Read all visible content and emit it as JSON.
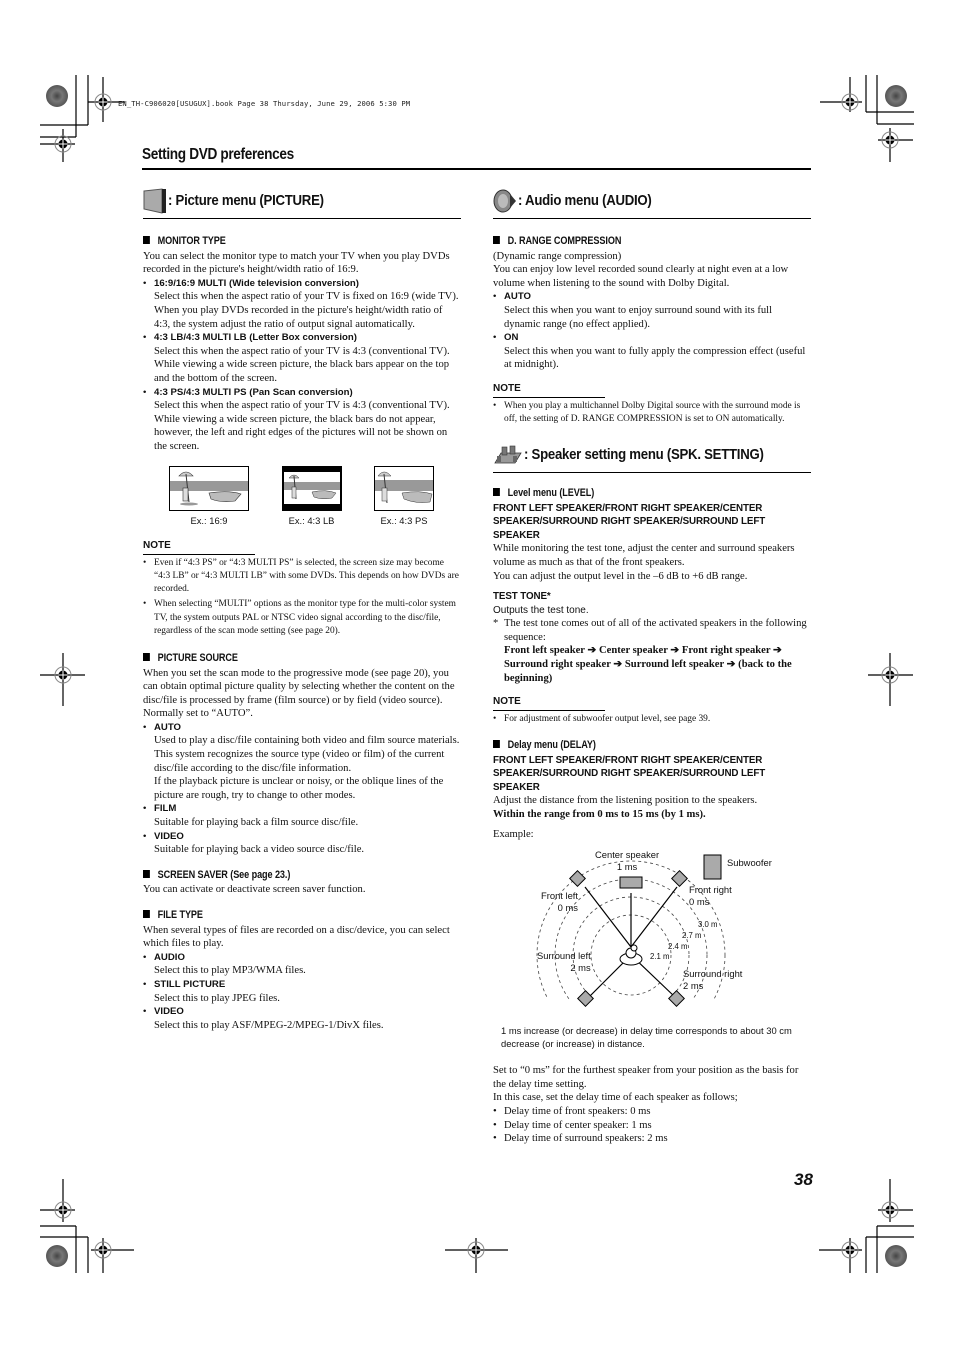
{
  "slug": "EN_TH-C906020[USUGUX].book  Page 38  Thursday, June 29, 2006  5:30 PM",
  "section_title": "Setting DVD preferences",
  "page_number": "38",
  "picture_menu": {
    "icon": "tv-screen-icon",
    "title": ": Picture menu (PICTURE)",
    "monitor_type": {
      "heading": "MONITOR TYPE",
      "intro": "You can select the monitor type to match your TV when you play DVDs recorded in the picture's height/width ratio of 16:9.",
      "options": [
        {
          "label": "16:9/16:9 MULTI (Wide television conversion)",
          "desc": [
            "Select this when the aspect ratio of your TV is fixed on 16:9 (wide TV).",
            "When you play DVDs recorded in the picture's height/width ratio of 4:3, the system adjust the ratio of output signal automatically."
          ]
        },
        {
          "label": "4:3 LB/4:3 MULTI LB (Letter Box conversion)",
          "desc": [
            "Select this when the aspect ratio of your TV is 4:3 (conventional TV). While viewing a wide screen picture, the black bars appear on the top and the bottom of the screen."
          ]
        },
        {
          "label": "4:3 PS/4:3 MULTI PS (Pan Scan conversion)",
          "desc": [
            "Select this when the aspect ratio of your TV is 4:3 (conventional TV). While viewing a wide screen picture, the black bars do not appear, however, the left and right edges of the pictures will not be shown on the screen."
          ]
        }
      ],
      "examples": [
        "Ex.: 16:9",
        "Ex.: 4:3 LB",
        "Ex.: 4:3 PS"
      ],
      "note_heading": "NOTE",
      "notes": [
        "Even if “4:3 PS” or “4:3 MULTI PS” is selected, the screen size may become “4:3 LB” or “4:3 MULTI LB” with some DVDs. This depends on how DVDs are recorded.",
        "When selecting “MULTI” options as the monitor type for the multi-color system TV, the system outputs PAL or NTSC video signal according to the disc/file, regardless of the scan mode setting (see page 20)."
      ]
    },
    "picture_source": {
      "heading": "PICTURE SOURCE",
      "intro": "When you set the scan mode to the progressive mode (see page 20), you can obtain optimal picture quality by selecting whether the content on the disc/file is processed by frame (film source) or by field (video source).",
      "default": "Normally set to “AUTO”.",
      "options": [
        {
          "label": "AUTO",
          "desc": [
            "Used to play a disc/file containing both video and film source materials.",
            "This system recognizes the source type (video or film) of the current disc/file according to the disc/file information.",
            "If the playback picture is unclear or noisy, or the oblique lines of the picture are rough, try to change to other modes."
          ]
        },
        {
          "label": "FILM",
          "desc": [
            "Suitable for playing back a film source disc/file."
          ]
        },
        {
          "label": "VIDEO",
          "desc": [
            "Suitable for playing back a video source disc/file."
          ]
        }
      ]
    },
    "screen_saver": {
      "heading": "SCREEN SAVER (See page 23.)",
      "text": "You can activate or deactivate screen saver function."
    },
    "file_type": {
      "heading": "FILE TYPE",
      "intro": "When several types of files are recorded on a disc/device, you can select which files to play.",
      "options": [
        {
          "label": "AUDIO",
          "desc": [
            "Select this to play MP3/WMA files."
          ]
        },
        {
          "label": "STILL PICTURE",
          "desc": [
            "Select this to play JPEG files."
          ]
        },
        {
          "label": "VIDEO",
          "desc": [
            "Select this to play ASF/MPEG-2/MPEG-1/DivX files."
          ]
        }
      ]
    }
  },
  "audio_menu": {
    "icon": "speaker-cone-icon",
    "title": ": Audio menu (AUDIO)",
    "drc": {
      "heading": "D. RANGE COMPRESSION",
      "subtitle": "(Dynamic range compression)",
      "intro": "You can enjoy low level recorded sound clearly at night even at a low volume when listening to the sound with Dolby Digital.",
      "options": [
        {
          "label": "AUTO",
          "desc": [
            "Select this when you want to enjoy surround sound with its full dynamic range (no effect applied)."
          ]
        },
        {
          "label": "ON",
          "desc": [
            "Select this when you want to fully apply the compression effect (useful at midnight)."
          ]
        }
      ],
      "note_heading": "NOTE",
      "notes": [
        "When you play a multichannel Dolby Digital source with the surround mode is off, the setting of D. RANGE COMPRESSION is set to ON automatically."
      ]
    }
  },
  "speaker_menu": {
    "icon": "speaker-setup-icon",
    "title": ": Speaker setting menu (SPK. SETTING)",
    "level": {
      "heading": "Level menu (LEVEL)",
      "speakers": "FRONT LEFT SPEAKER/FRONT RIGHT SPEAKER/CENTER SPEAKER/SURROUND RIGHT SPEAKER/SURROUND LEFT SPEAKER",
      "text1": "While monitoring the test tone, adjust the center and surround speakers volume as much as that of the front speakers.",
      "text2": "You can adjust the output level in the –6 dB to +6 dB range.",
      "test_tone_label": "TEST TONE*",
      "test_tone_text": "Outputs the test tone.",
      "footnote": "The test tone comes out of all of the activated speakers in the following sequence:",
      "sequence": "Front left speaker ➔ Center speaker ➔ Front right speaker ➔ Surround right speaker ➔ Surround left speaker ➔ (back to the beginning)",
      "note_heading": "NOTE",
      "notes": [
        "For adjustment of subwoofer output level, see page 39."
      ]
    },
    "delay": {
      "heading": "Delay menu (DELAY)",
      "speakers": "FRONT LEFT SPEAKER/FRONT RIGHT SPEAKER/CENTER SPEAKER/SURROUND RIGHT SPEAKER/SURROUND LEFT SPEAKER",
      "text": "Adjust the distance from the listening position to the speakers.",
      "range": "Within the range from 0 ms to 15 ms (by 1 ms).",
      "example_label": "Example:",
      "diagram": {
        "center": {
          "name": "Center speaker",
          "value": "1 ms"
        },
        "subwoofer": "Subwoofer",
        "front_left": {
          "name": "Front left",
          "value": "0 ms"
        },
        "front_right": {
          "name": "Front right",
          "value": "0 ms"
        },
        "surround_left": {
          "name": "Surround left",
          "value": "2 ms"
        },
        "surround_right": {
          "name": "Surround right",
          "value": "2 ms"
        },
        "distances": [
          "3.0 m",
          "2.7 m",
          "2.4 m",
          "2.1 m"
        ],
        "caption": "1 ms increase (or decrease) in delay time corresponds to about 30 cm decrease (or increase) in distance."
      },
      "after_text1": "Set to “0 ms” for the furthest speaker from your position as the basis for the delay time setting.",
      "after_text2": "In this case, set the delay time of each speaker as follows;",
      "list": [
        "Delay time of front speakers: 0 ms",
        "Delay time of center speaker: 1 ms",
        "Delay time of surround speakers: 2 ms"
      ]
    }
  }
}
